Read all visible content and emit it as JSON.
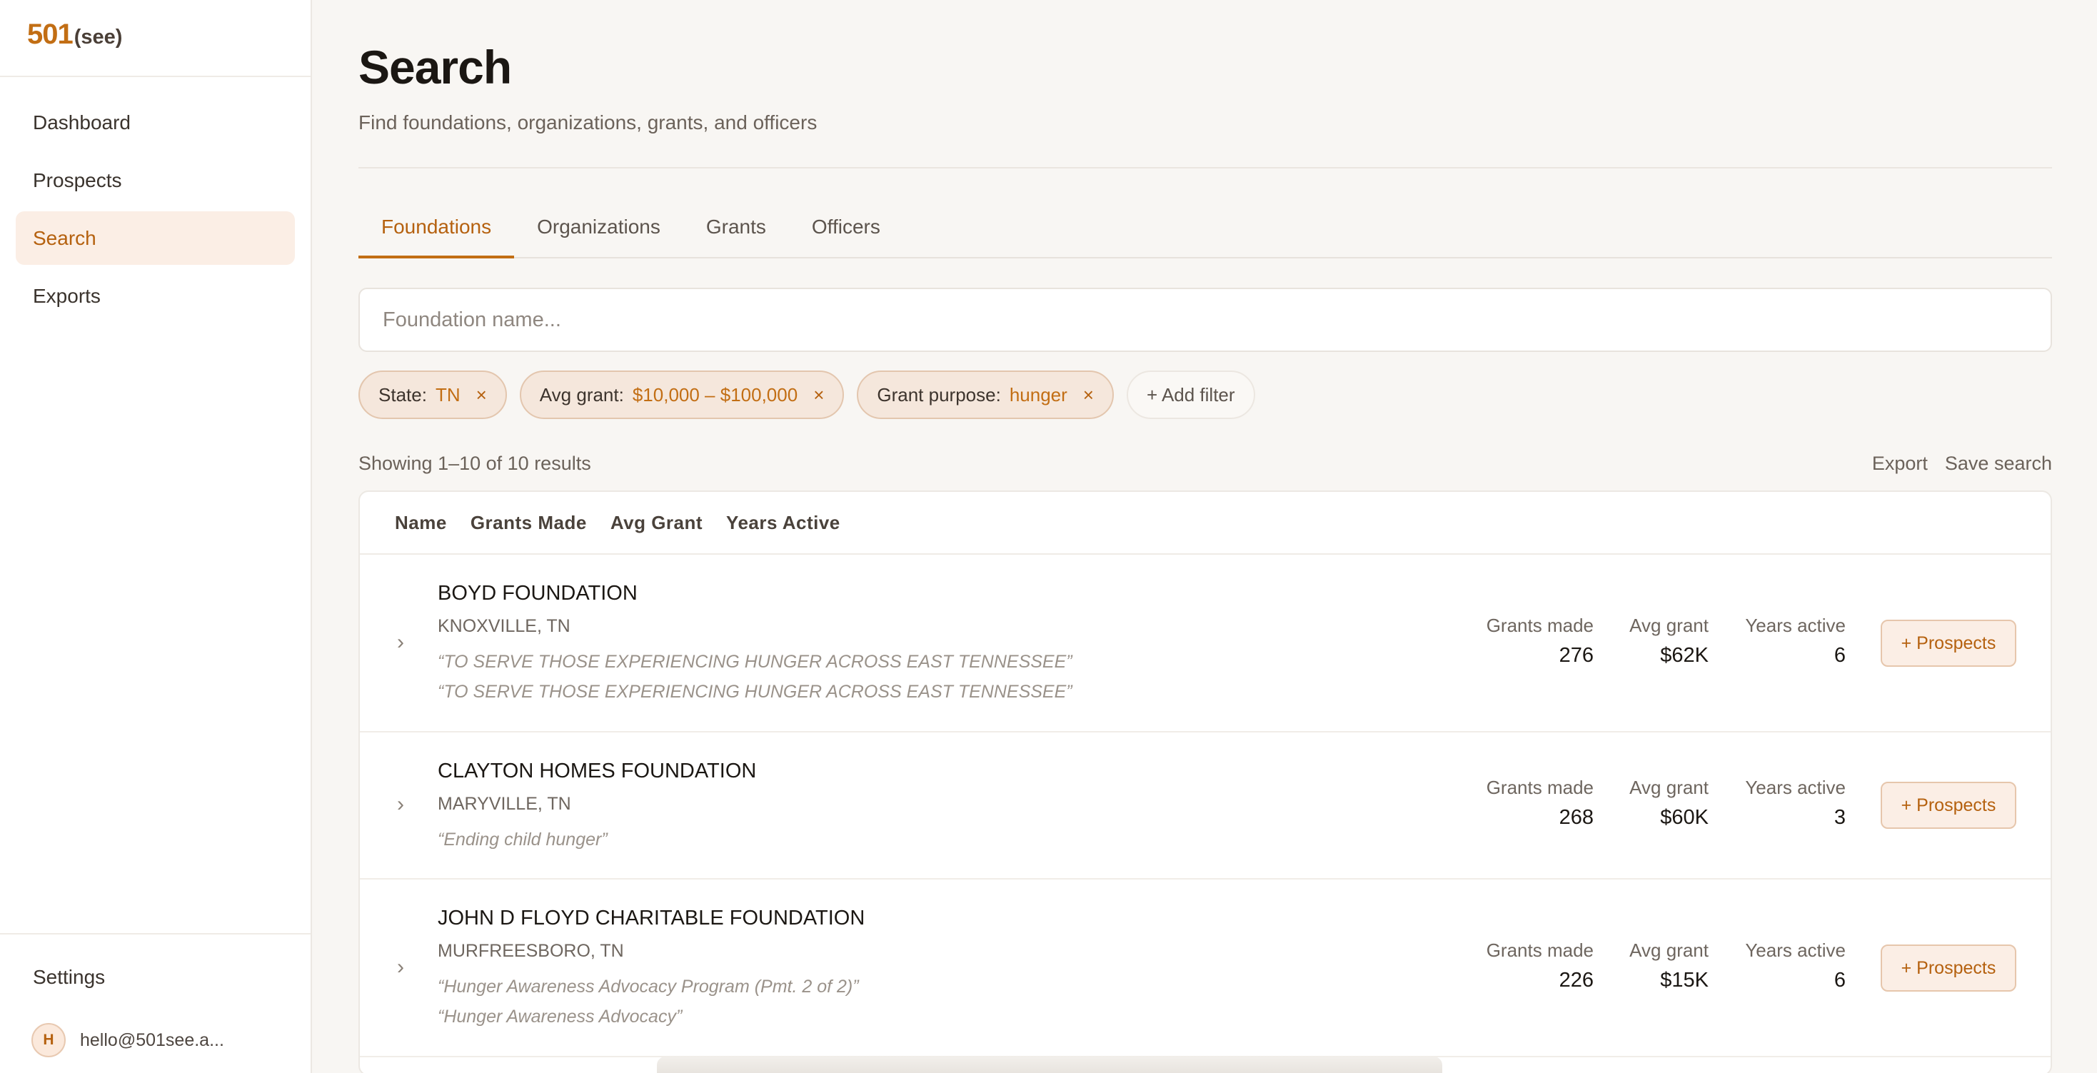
{
  "brand": {
    "num": "501",
    "see": "(see)"
  },
  "nav": [
    "Dashboard",
    "Prospects",
    "Search",
    "Exports"
  ],
  "sidebar_bottom": {
    "settings": "Settings",
    "avatar_letter": "H",
    "email": "hello@501see.a..."
  },
  "page": {
    "title": "Search",
    "subtitle": "Find foundations, organizations, grants, and officers"
  },
  "tabs": [
    "Foundations",
    "Organizations",
    "Grants",
    "Officers"
  ],
  "search": {
    "placeholder": "Foundation name..."
  },
  "filters": [
    {
      "label": "State:",
      "value": "TN"
    },
    {
      "label": "Avg grant:",
      "value": "$10,000 – $100,000"
    },
    {
      "label": "Grant purpose:",
      "value": "hunger"
    }
  ],
  "add_filter": "+ Add filter",
  "results": {
    "count": "Showing 1–10 of 10 results",
    "export": "Export",
    "save": "Save search"
  },
  "columns": [
    "Name",
    "Grants Made",
    "Avg Grant",
    "Years Active"
  ],
  "stat_labels": {
    "grants": "Grants made",
    "avg": "Avg grant",
    "years": "Years active"
  },
  "prospect_label": "+ Prospects",
  "rows": [
    {
      "name": "BOYD FOUNDATION",
      "location": "KNOXVILLE, TN",
      "descriptions": [
        "“TO SERVE THOSE EXPERIENCING HUNGER ACROSS EAST TENNESSEE”",
        "“TO SERVE THOSE EXPERIENCING HUNGER ACROSS EAST TENNESSEE”"
      ],
      "grants_made": "276",
      "avg_grant": "$62K",
      "years_active": "6"
    },
    {
      "name": "CLAYTON HOMES FOUNDATION",
      "location": "MARYVILLE, TN",
      "descriptions": [
        "“Ending child hunger”"
      ],
      "grants_made": "268",
      "avg_grant": "$60K",
      "years_active": "3"
    },
    {
      "name": "JOHN D FLOYD CHARITABLE FOUNDATION",
      "location": "MURFREESBORO, TN",
      "descriptions": [
        "“Hunger Awareness Advocacy Program (Pmt. 2 of 2)”",
        "“Hunger Awareness Advocacy”"
      ],
      "grants_made": "226",
      "avg_grant": "$15K",
      "years_active": "6"
    }
  ]
}
